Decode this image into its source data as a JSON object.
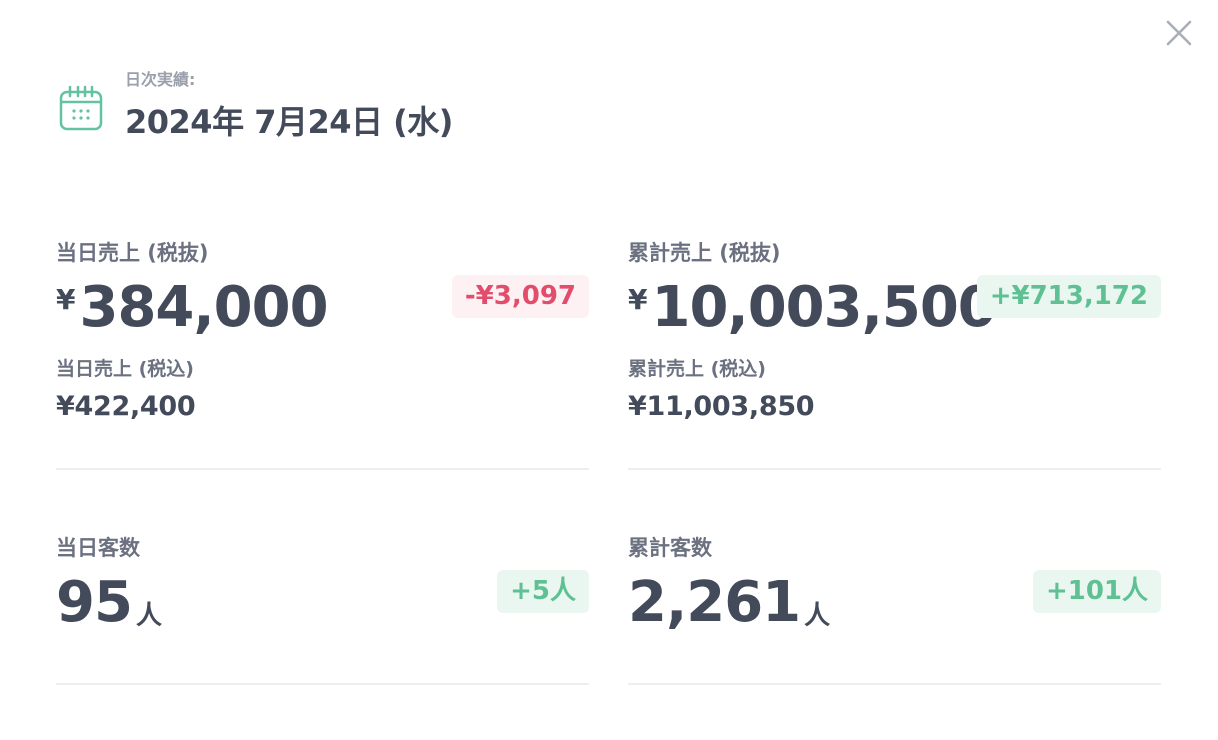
{
  "header": {
    "label": "日次実績:",
    "date": "2024年 7月24日 (水)"
  },
  "sales_day": {
    "label": "当日売上 (税抜)",
    "currency": "¥",
    "value": "384,000",
    "diff": "-¥3,097",
    "sub_label": "当日売上 (税込)",
    "sub_value": "¥422,400"
  },
  "sales_total": {
    "label": "累計売上 (税抜)",
    "currency": "¥",
    "value": "10,003,500",
    "diff": "+¥713,172",
    "sub_label": "累計売上 (税込)",
    "sub_value": "¥11,003,850"
  },
  "customers_day": {
    "label": "当日客数",
    "value": "95",
    "unit": "人",
    "diff": "+5人"
  },
  "customers_total": {
    "label": "累計客数",
    "value": "2,261",
    "unit": "人",
    "diff": "+101人"
  },
  "colors": {
    "text": "#434a5a",
    "muted": "#6b7180",
    "negative": "#e34d6c",
    "negative_bg": "#fdf1f3",
    "positive": "#5ec093",
    "positive_bg": "#eaf7f1",
    "icon_accent": "#63c2a0"
  },
  "icons": {
    "close": "close-icon",
    "calendar": "calendar-icon"
  }
}
